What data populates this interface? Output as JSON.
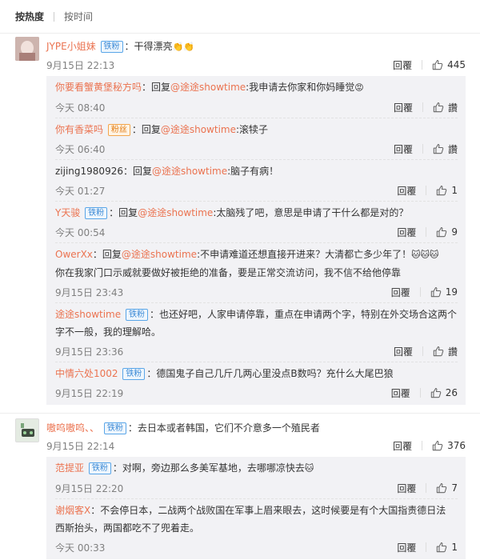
{
  "sort": {
    "active": "按热度",
    "inactive": "按时间"
  },
  "actions": {
    "reply": "回覆",
    "like_icon": "thumbs-up-icon"
  },
  "comments": [
    {
      "user": "JYPE小姐妹",
      "badge": "铁粉",
      "text": "：干得漂亮",
      "emoji": "👏👏",
      "time": "9月15日 22:13",
      "likes": "445",
      "replies": [
        {
          "user": "你要看蟹黄堡秘方吗",
          "prefix": "：回复",
          "to": "@途途showtime",
          "text": ":我申请去你家和你妈睡觉",
          "emoji": "😡",
          "time": "今天 08:40",
          "likes": "讚"
        },
        {
          "user": "你有香菜吗",
          "badge": "粉丝",
          "prefix": "：回复",
          "to": "@途途showtime",
          "text": ":滚犊子",
          "time": "今天 06:40",
          "likes": "讚"
        },
        {
          "user": "zijing1980926",
          "prefix": "：回复",
          "to": "@途途showtime",
          "text": ":脑子有病！",
          "time": "今天 01:27",
          "likes": "1"
        },
        {
          "user": "Y天骏",
          "badge": "铁粉",
          "prefix": "：回复",
          "to": "@途途showtime",
          "text": ":太脑残了吧，意思是申请了干什么都是对的？",
          "time": "今天 00:54",
          "likes": "9"
        },
        {
          "user": "OwerXx",
          "prefix": "：回复",
          "to": "@途途showtime",
          "text": ":不申请难道还想直接开进来？大清都亡多少年了！",
          "emoji": "🐱🐱🐱",
          "text2": "你在我家门口示威就要做好被拒绝的准备，要是正常交流访问，我不信不给他停靠",
          "time": "9月15日 23:43",
          "likes": "19"
        },
        {
          "user": "途途showtime",
          "badge": "铁粉",
          "text": "：也还好吧，人家申请停靠，重点在申请两个字，特别在外交场合这两个",
          "text2": "字不一般，我的理解哈。",
          "time": "9月15日 23:36",
          "likes": "讚"
        },
        {
          "user": "中情六处1002",
          "badge": "铁粉",
          "text": "：德国鬼子自己几斤几两心里没点B数吗？充什么大尾巴狼",
          "time": "9月15日 22:19",
          "likes": "26"
        }
      ]
    },
    {
      "user": "嗷呜嗷呜、、",
      "badge": "铁粉",
      "text": "：去日本或者韩国，它们不介意多一个殖民者",
      "time": "9月15日 22:14",
      "likes": "376",
      "replies": [
        {
          "user": "范提亚",
          "badge": "铁粉",
          "text": "：对啊，旁边那么多美军基地，去哪哪凉快去",
          "emoji": "🐱",
          "time": "9月15日 22:20",
          "likes": "7"
        },
        {
          "user": "谢烟客X",
          "text": "：不会停日本，二战两个战败国在军事上眉来眼去，这时候要是有个大国指责德日法",
          "text2": "西斯抬头，两国都吃不了兜着走。",
          "time": "今天 00:33",
          "likes": "1"
        }
      ]
    }
  ]
}
